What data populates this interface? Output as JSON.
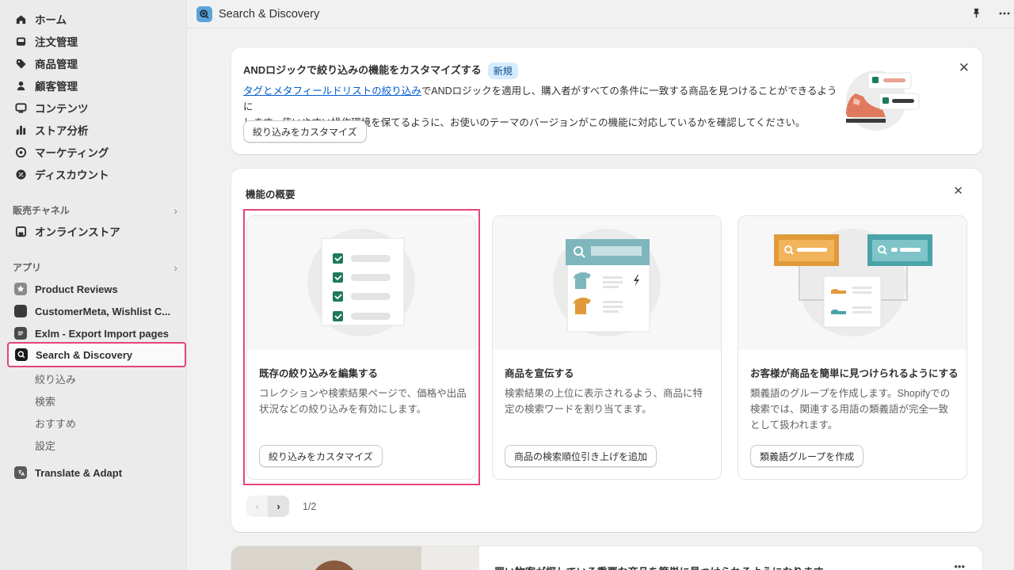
{
  "sidebar": {
    "main": [
      {
        "label": "ホーム",
        "icon": "home-icon"
      },
      {
        "label": "注文管理",
        "icon": "inbox-icon"
      },
      {
        "label": "商品管理",
        "icon": "tag-icon"
      },
      {
        "label": "顧客管理",
        "icon": "person-icon"
      },
      {
        "label": "コンテンツ",
        "icon": "content-icon"
      },
      {
        "label": "ストア分析",
        "icon": "bar-chart-icon"
      },
      {
        "label": "マーケティング",
        "icon": "target-icon"
      },
      {
        "label": "ディスカウント",
        "icon": "discount-icon"
      }
    ],
    "sales_channels_label": "販売チャネル",
    "online_store": "オンラインストア",
    "apps_label": "アプリ",
    "apps": [
      {
        "label": "Product Reviews"
      },
      {
        "label": "CustomerMeta, Wishlist C..."
      },
      {
        "label": "Exlm - Export Import pages"
      },
      {
        "label": "Search & Discovery"
      }
    ],
    "sub_items": [
      "絞り込み",
      "検索",
      "おすすめ",
      "設定"
    ],
    "translate": "Translate & Adapt"
  },
  "topbar": {
    "title": "Search & Discovery"
  },
  "banner": {
    "title": "ANDロジックで絞り込みの機能をカスタマイズする",
    "badge": "新規",
    "link_text": "タグとメタフィールドリストの絞り込み",
    "body_1": "でANDロジックを適用し、購入者がすべての条件に一致する商品を見つけることができるように",
    "body_2": "します。使いやすい操作環境を保てるように、お使いのテーマのバージョンがこの機能に対応しているかを確認してください。",
    "button": "絞り込みをカスタマイズ"
  },
  "overview": {
    "title": "機能の概要",
    "features": [
      {
        "title": "既存の絞り込みを編集する",
        "desc": "コレクションや検索結果ページで、価格や出品状況などの絞り込みを有効にします。",
        "button": "絞り込みをカスタマイズ"
      },
      {
        "title": "商品を宣伝する",
        "desc": "検索結果の上位に表示されるよう、商品に特定の検索ワードを割り当てます。",
        "button": "商品の検索順位引き上げを追加"
      },
      {
        "title": "お客様が商品を簡単に見つけられるようにする",
        "desc": "類義語のグループを作成します。Shopifyでの検索では、関連する用語の類義語が完全一致として扱われます。",
        "button": "類義語グループを作成"
      }
    ],
    "page_indicator": "1/2"
  },
  "bottom_card": {
    "title": "買い物客が探している重要な商品を簡単に見つけられるようになります"
  },
  "colors": {
    "highlight": "#e5457a",
    "link": "#005bd3",
    "badge_bg": "#d5ebff",
    "check_green": "#1f7a5a",
    "accent_orange": "#e09a3a",
    "accent_teal": "#4aa3a9"
  }
}
